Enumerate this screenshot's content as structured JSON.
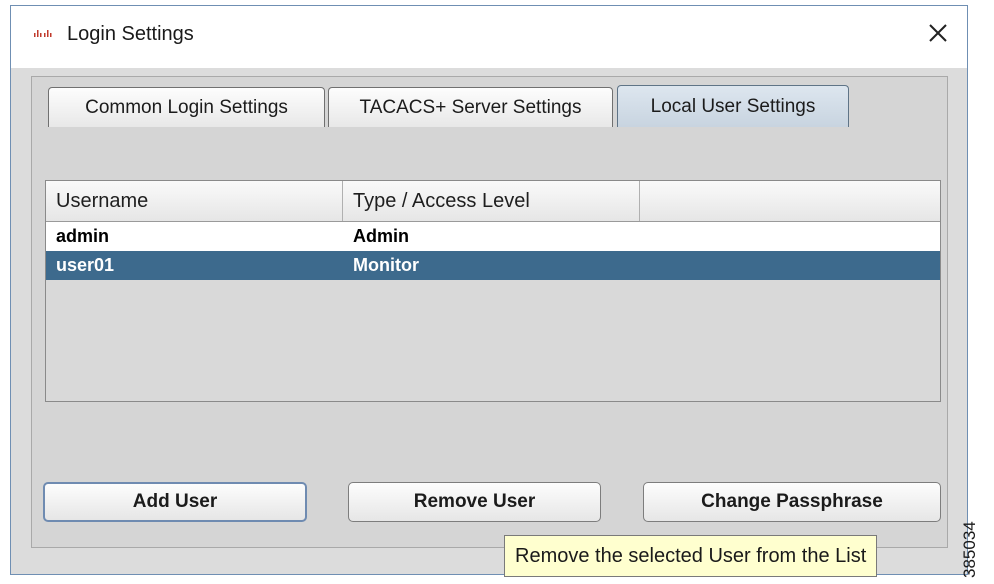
{
  "window": {
    "title": "Login Settings",
    "close_icon": "close-icon",
    "app_icon": "cisco-logo-icon"
  },
  "tabs": [
    {
      "label": "Common Login Settings",
      "active": false
    },
    {
      "label": "TACACS+ Server Settings",
      "active": false
    },
    {
      "label": "Local User Settings",
      "active": true
    }
  ],
  "table": {
    "columns": [
      "Username",
      "Type / Access Level",
      ""
    ],
    "rows": [
      {
        "username": "admin",
        "type": "Admin",
        "selected": false
      },
      {
        "username": "user01",
        "type": "Monitor",
        "selected": true
      }
    ]
  },
  "buttons": {
    "add_user": "Add User",
    "remove_user": "Remove User",
    "change_passphrase": "Change Passphrase"
  },
  "tooltip": "Remove the selected User from the List",
  "figure_id": "385034",
  "colors": {
    "selection": "#3d6a8d",
    "tooltip_bg": "#ffffcf",
    "dialog_bg": "#d5d5d5"
  }
}
